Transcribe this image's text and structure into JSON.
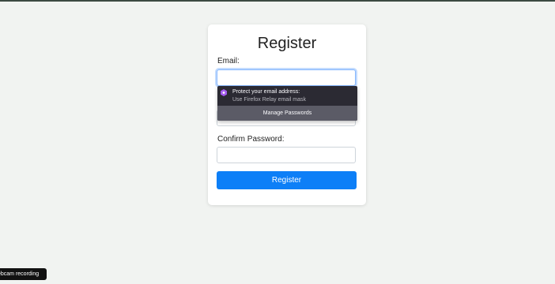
{
  "form": {
    "title": "Register",
    "email_label": "Email:",
    "email_value": "",
    "confirm_password_label": "Confirm Password:",
    "confirm_password_value": "",
    "submit_label": "Register"
  },
  "autofill_popup": {
    "icon": "firefox-relay-icon",
    "relay_title": "Protect your email address:",
    "relay_subtitle": "Use Firefox Relay email mask",
    "manage_label": "Manage Passwords"
  },
  "overlay": {
    "webcam_label": "ebcam recording"
  },
  "colors": {
    "primary_button": "#0d7ff7",
    "relay_accent": "#a55cf0",
    "popup_background": "#2b2a33"
  }
}
